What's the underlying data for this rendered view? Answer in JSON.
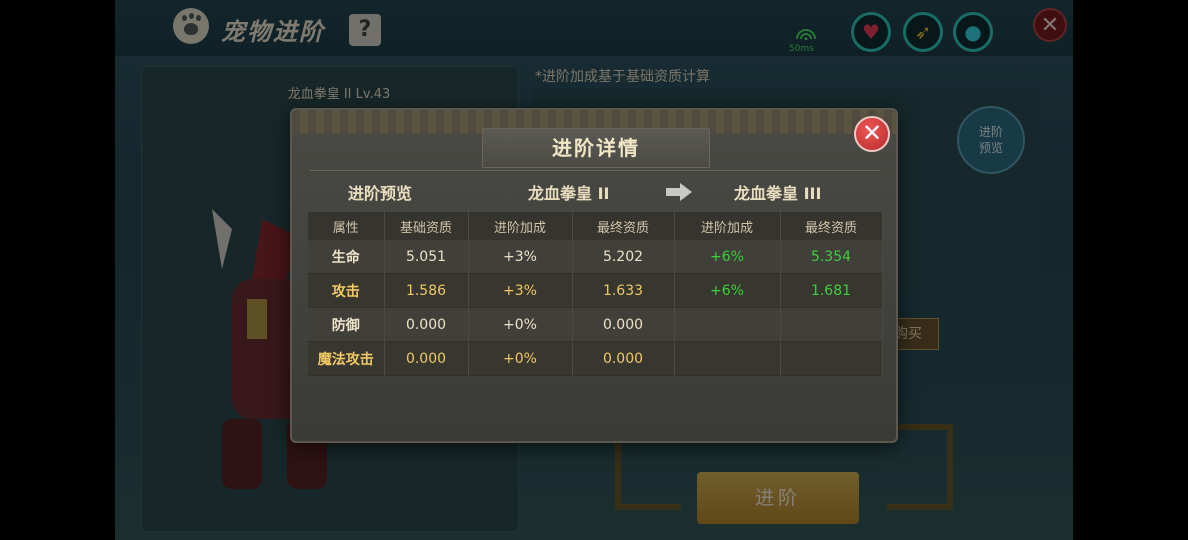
{
  "header": {
    "title": "宠物进阶",
    "help": "?"
  },
  "status": {
    "ping": "50ms"
  },
  "pet": {
    "name_level": "龙血拳皇 II Lv.43"
  },
  "background_panel": {
    "note": "*进阶加成基于基础资质计算",
    "preview_button": "进阶\n预览",
    "buy_button": "购买",
    "advance_button": "进阶"
  },
  "modal": {
    "title": "进阶详情",
    "preview_label": "进阶预览",
    "from_form": "龙血拳皇 II",
    "to_form": "龙血拳皇 III",
    "columns": [
      "属性",
      "基础资质",
      "进阶加成",
      "最终资质",
      "进阶加成",
      "最终资质"
    ],
    "rows": [
      {
        "attr": "生命",
        "base": "5.051",
        "bonus_now": "+3%",
        "final_now": "5.202",
        "bonus_next": "+6%",
        "final_next": "5.354"
      },
      {
        "attr": "攻击",
        "base": "1.586",
        "bonus_now": "+3%",
        "final_now": "1.633",
        "bonus_next": "+6%",
        "final_next": "1.681"
      },
      {
        "attr": "防御",
        "base": "0.000",
        "bonus_now": "+0%",
        "final_now": "0.000",
        "bonus_next": "",
        "final_next": ""
      },
      {
        "attr": "魔法攻击",
        "base": "0.000",
        "bonus_now": "+0%",
        "final_now": "0.000",
        "bonus_next": "",
        "final_next": ""
      }
    ]
  },
  "colors": {
    "gold": "#f0c864",
    "green": "#3ccf3c",
    "accent_teal": "#2ed0c0"
  }
}
